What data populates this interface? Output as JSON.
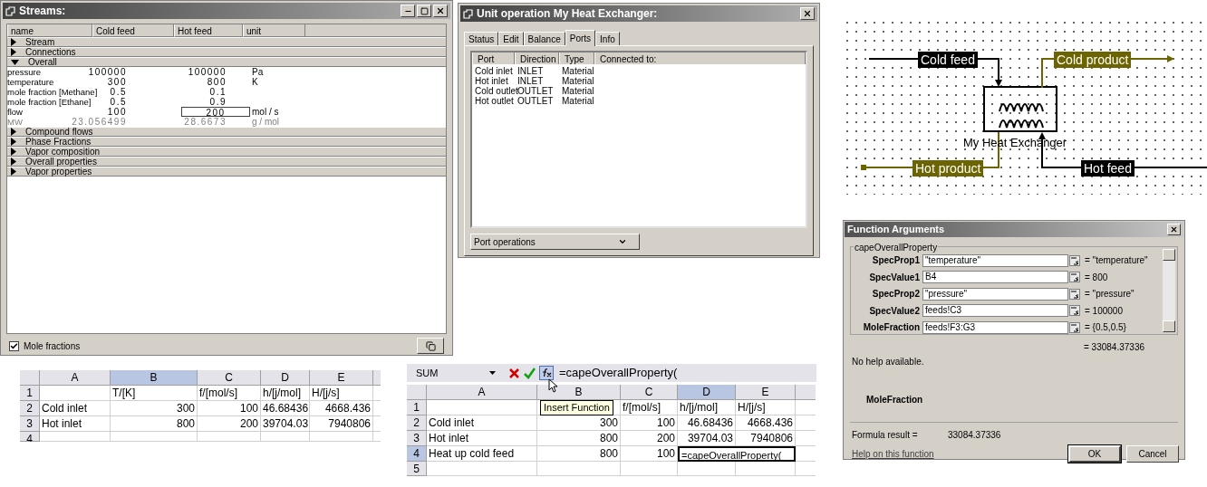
{
  "streams_window": {
    "title": "Streams:",
    "columns": [
      "name",
      "Cold feed",
      "Hot feed",
      "unit"
    ],
    "sections": [
      {
        "label": "Stream",
        "expanded": false
      },
      {
        "label": "Connections",
        "expanded": false
      },
      {
        "label": "Overall",
        "expanded": true,
        "rows": [
          {
            "name": "pressure",
            "disabled": false,
            "unit": "Pa",
            "values": [
              {
                "text": "100000",
                "editing": false
              },
              {
                "text": "100000",
                "editing": false
              }
            ]
          },
          {
            "name": "temperature",
            "disabled": false,
            "unit": "K",
            "values": [
              {
                "text": "300",
                "editing": false
              },
              {
                "text": "800",
                "editing": false
              }
            ]
          },
          {
            "name": "mole fraction [Methane]",
            "disabled": false,
            "values": [
              {
                "text": "0.5",
                "editing": false
              },
              {
                "text": "0.1",
                "editing": false
              }
            ]
          },
          {
            "name": "mole fraction [Ethane]",
            "disabled": false,
            "values": [
              {
                "text": "0.5",
                "editing": false
              },
              {
                "text": "0.9",
                "editing": false
              }
            ]
          },
          {
            "name": "flow",
            "disabled": false,
            "unit": "mol / s",
            "values": [
              {
                "text": "100",
                "editing": false
              },
              {
                "text": "200",
                "editing": true
              }
            ]
          },
          {
            "name": "MW",
            "disabled": true,
            "unit": "g / mol",
            "values": [
              {
                "text": "23.056499",
                "editing": false
              },
              {
                "text": "28.6673",
                "editing": false
              }
            ]
          }
        ]
      },
      {
        "label": "Compound flows",
        "expanded": false
      },
      {
        "label": "Phase Fractions",
        "expanded": false
      },
      {
        "label": "Vapor composition",
        "expanded": false
      },
      {
        "label": "Overall properties",
        "expanded": false
      },
      {
        "label": "Vapor properties",
        "expanded": false
      }
    ],
    "mole_fractions": {
      "label": "Mole fractions",
      "checked": true
    }
  },
  "unit_window": {
    "title": "Unit operation My Heat Exchanger:",
    "tabs": [
      {
        "label": "Status",
        "selected": false
      },
      {
        "label": "Edit",
        "selected": false
      },
      {
        "label": "Balance",
        "selected": false
      },
      {
        "label": "Ports",
        "selected": true
      },
      {
        "label": "Info",
        "selected": false
      }
    ],
    "columns": [
      "Port",
      "Direction",
      "Type",
      "Connected to:"
    ],
    "rows": [
      [
        "Cold inlet",
        "INLET",
        "Material"
      ],
      [
        "Hot inlet",
        "INLET",
        "Material"
      ],
      [
        "Cold outlet",
        "OUTLET",
        "Material"
      ],
      [
        "Hot outlet",
        "OUTLET",
        "Material"
      ]
    ],
    "dropdown": "Port operations"
  },
  "diagram": {
    "unit_label": "My Heat Exchanger",
    "streams": [
      {
        "label": "Cold feed",
        "kind": "feed"
      },
      {
        "label": "Cold product",
        "kind": "product"
      },
      {
        "label": "Hot product",
        "kind": "product"
      },
      {
        "label": "Hot feed",
        "kind": "feed"
      }
    ]
  },
  "function_arguments": {
    "title": "Function Arguments",
    "function_name": "capeOverallProperty",
    "args": [
      {
        "name": "SpecProp1",
        "value": "\"temperature\"",
        "result": "= \"temperature\""
      },
      {
        "name": "SpecValue1",
        "value": "B4",
        "result": "= 800"
      },
      {
        "name": "SpecProp2",
        "value": "\"pressure\"",
        "result": "= \"pressure\""
      },
      {
        "name": "SpecValue2",
        "value": "feeds!C3",
        "result": "= 100000"
      },
      {
        "name": "MoleFraction",
        "value": "feeds!F3:G3",
        "result": "= {0.5,0.5}"
      }
    ],
    "result": "= 33084.37336",
    "help": "No help available.",
    "current_arg": "MoleFraction",
    "formula_result_label": "Formula result =",
    "formula_result": "33084.37336",
    "help_link": "Help on this function",
    "buttons": [
      {
        "label": "OK",
        "default": true
      },
      {
        "label": "Cancel",
        "default": false
      }
    ]
  },
  "sheet_1": {
    "columns": [
      {
        "label": "A",
        "selected": false
      },
      {
        "label": "B",
        "selected": true
      },
      {
        "label": "C",
        "selected": false
      },
      {
        "label": "D",
        "selected": false
      },
      {
        "label": "E",
        "selected": false
      }
    ],
    "rows": [
      {
        "header": "1",
        "selected": false,
        "cells": [
          null,
          "T/[K]",
          "f/[mol/s]",
          "h/[j/mol]",
          "H/[j/s]"
        ]
      },
      {
        "header": "2",
        "selected": false,
        "cells": [
          "Cold inlet",
          "300",
          "100",
          "46.68436",
          "4668.436"
        ]
      },
      {
        "header": "3",
        "selected": false,
        "cells": [
          "Hot inlet",
          "800",
          "200",
          "39704.03",
          "7940806"
        ]
      },
      {
        "header": "4",
        "selected": false,
        "cells": []
      }
    ]
  },
  "sheet_2": {
    "name_box": "SUM",
    "formula": "=capeOverallProperty(",
    "tooltip": "Insert Function",
    "columns": [
      {
        "label": "A",
        "selected": false
      },
      {
        "label": "B",
        "selected": false
      },
      {
        "label": "C",
        "selected": false
      },
      {
        "label": "D",
        "selected": true
      },
      {
        "label": "E",
        "selected": false
      }
    ],
    "rows": [
      {
        "header": "1",
        "selected": false,
        "cells": [
          null,
          null,
          "f/[mol/s]",
          "h/[j/mol]",
          "H/[j/s]"
        ]
      },
      {
        "header": "2",
        "selected": false,
        "cells": [
          "Cold inlet",
          "300",
          "100",
          "46.68436",
          "4668.436"
        ]
      },
      {
        "header": "3",
        "selected": false,
        "cells": [
          "Hot inlet",
          "800",
          "200",
          "39704.03",
          "7940806"
        ]
      },
      {
        "header": "4",
        "selected": true,
        "cells": [
          "Heat up cold feed",
          "800",
          "100",
          {
            "text": "=capeOverallProperty(",
            "editing": true
          }
        ]
      },
      {
        "header": "5",
        "selected": false,
        "cells": []
      }
    ]
  }
}
